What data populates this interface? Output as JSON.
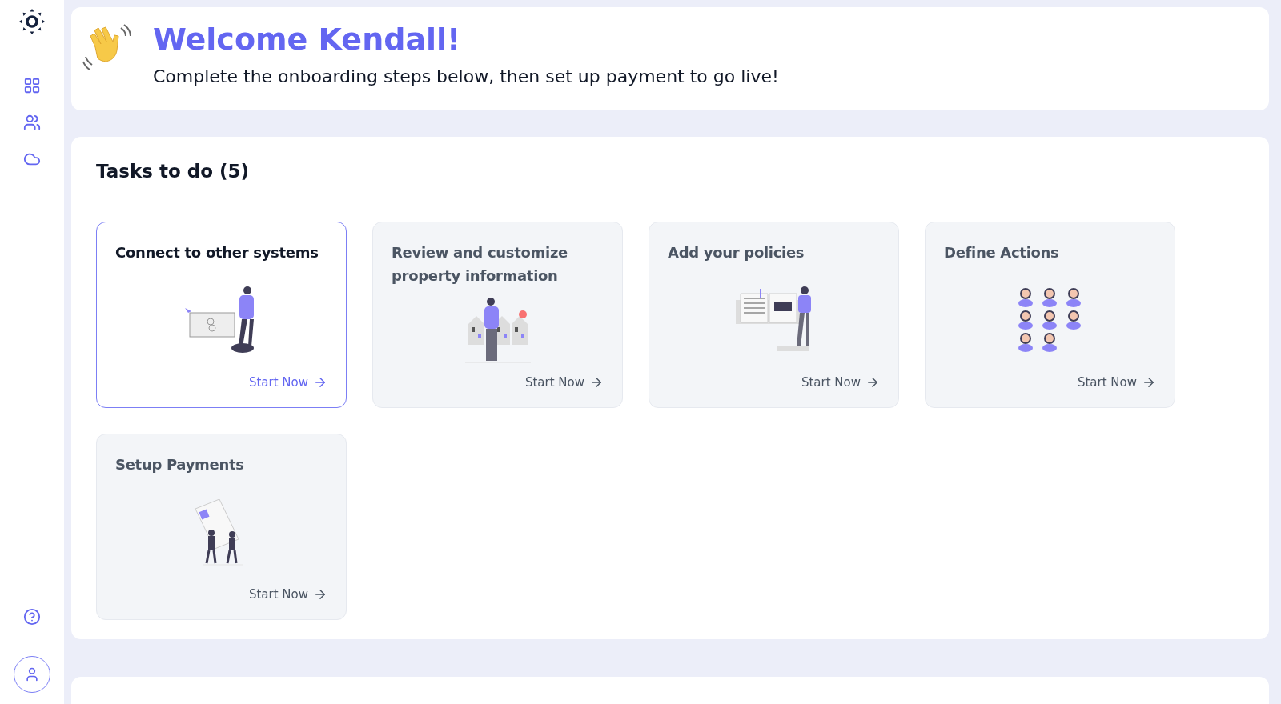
{
  "welcome": {
    "title": "Welcome Kendall!",
    "subtitle": "Complete the onboarding steps below, then set up payment to go live!"
  },
  "tasks_panel": {
    "heading": "Tasks to do (5)",
    "tasks": [
      {
        "kind": "connect",
        "title": "Connect to other systems",
        "action": "Start Now",
        "selected": true
      },
      {
        "kind": "property",
        "title": "Review and customize property information",
        "action": "Start Now",
        "selected": false
      },
      {
        "kind": "policies",
        "title": "Add your policies",
        "action": "Start Now",
        "selected": false
      },
      {
        "kind": "actions",
        "title": "Define Actions",
        "action": "Start Now",
        "selected": false
      },
      {
        "kind": "payments",
        "title": "Setup Payments",
        "action": "Start Now",
        "selected": false
      }
    ]
  }
}
